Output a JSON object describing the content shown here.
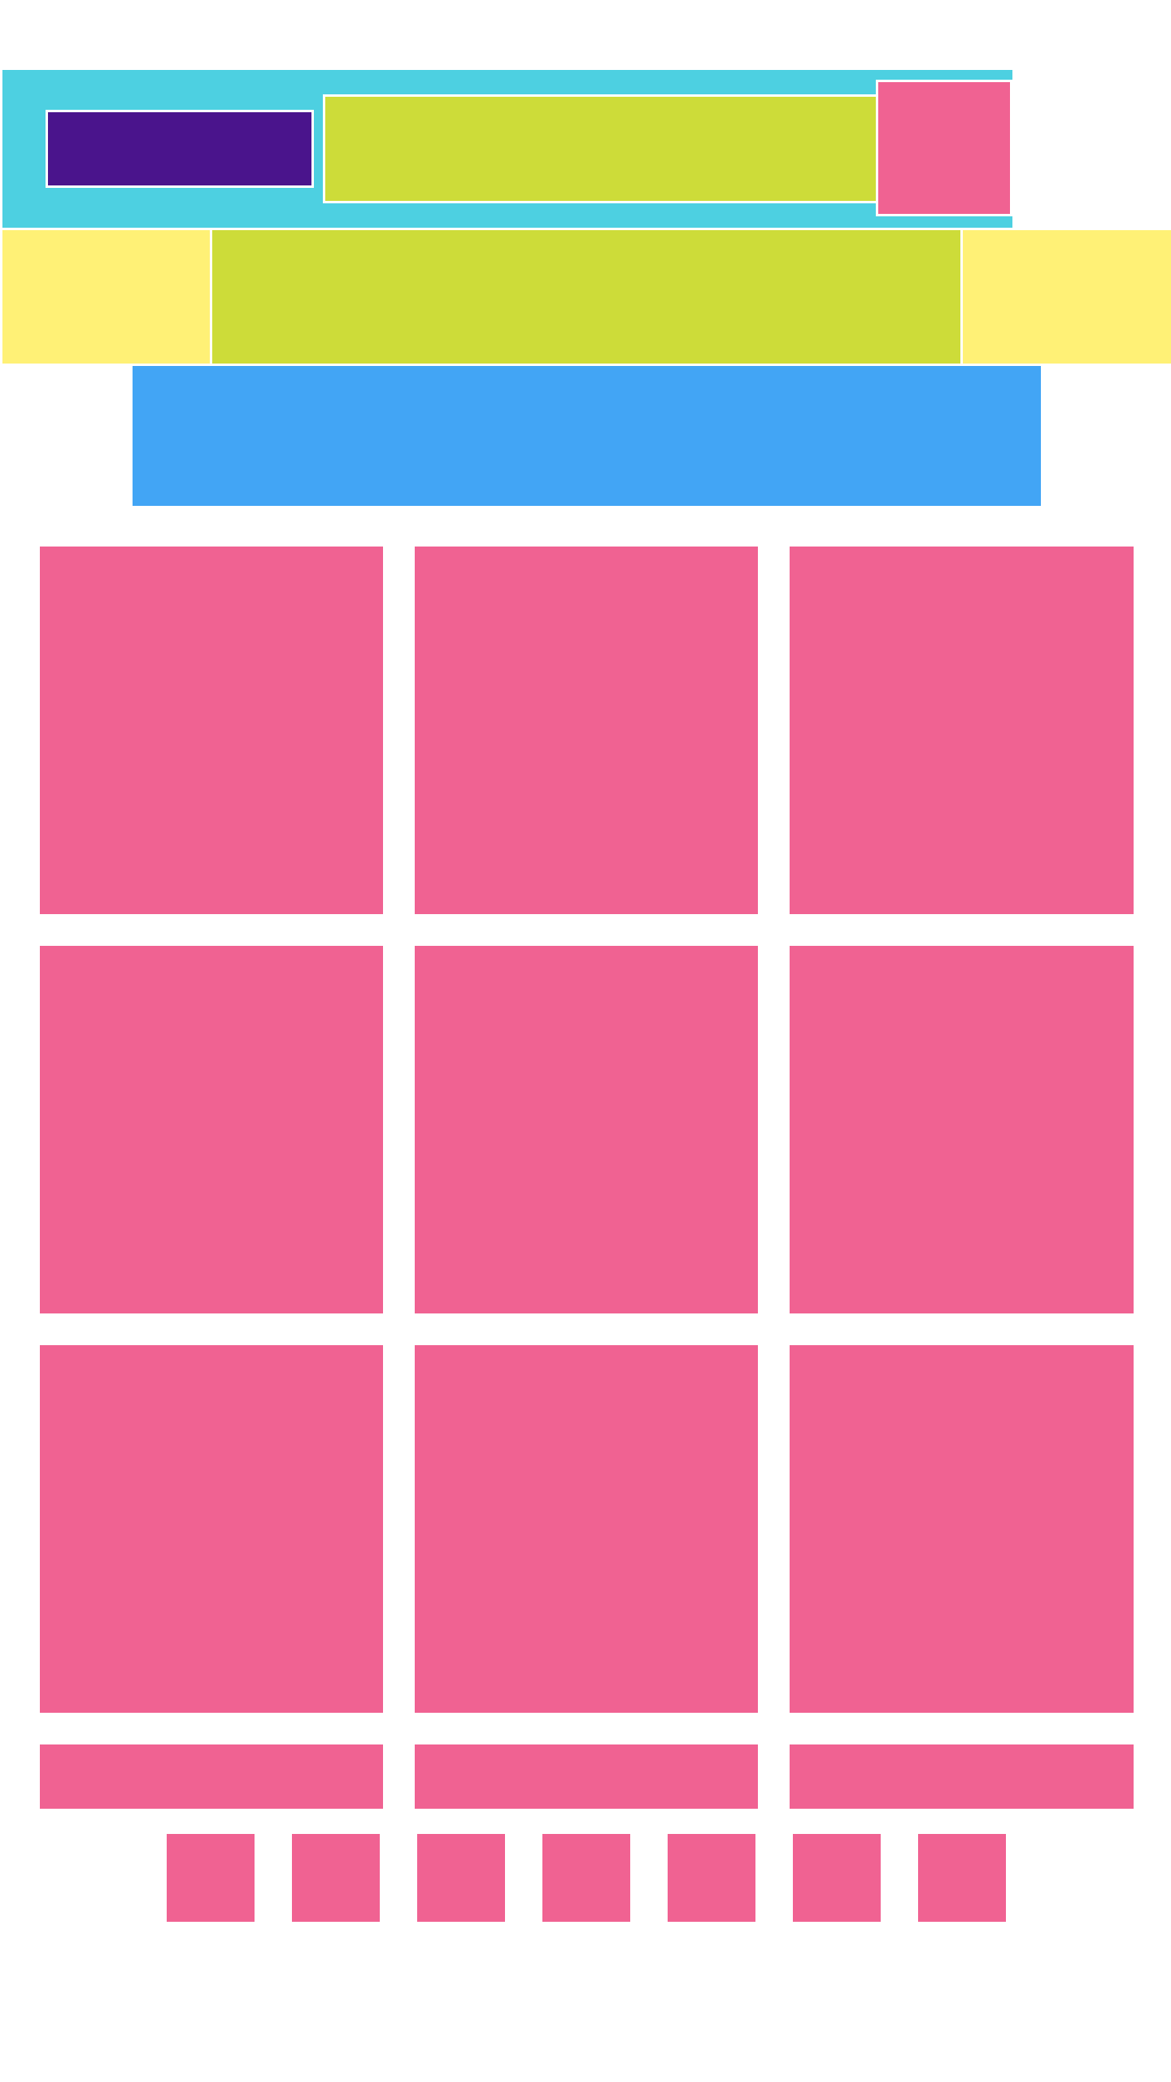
{
  "colors": {
    "header": "#4dd0e1",
    "logo": "#4a148c",
    "search": "#cddc39",
    "avatar": "#f06292",
    "nav_side": "#fff176",
    "nav_center": "#cddc39",
    "banner": "#42a5f5",
    "tile": "#f06292",
    "background": "#ffffff"
  },
  "grid": {
    "rows": 3,
    "columns": 3,
    "tiles": 9
  },
  "secondary_row": {
    "items": 3
  },
  "pager": {
    "items": 7
  }
}
